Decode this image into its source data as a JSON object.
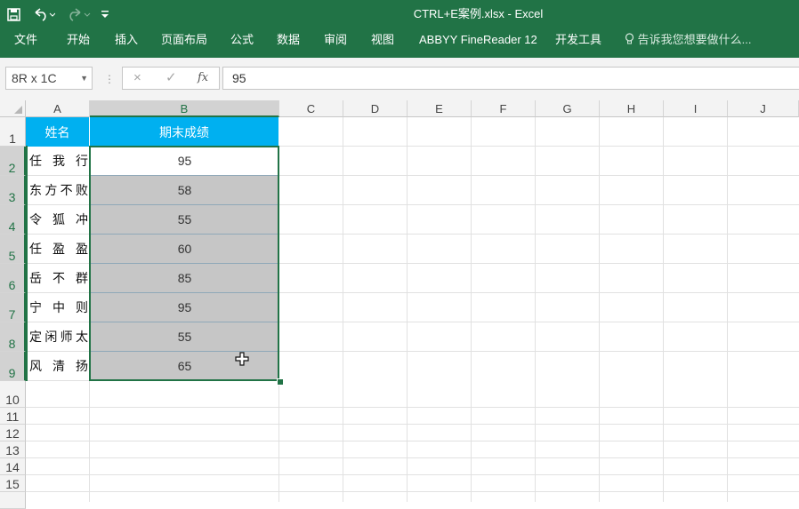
{
  "window": {
    "title": "CTRL+E案例.xlsx - Excel"
  },
  "quick_access": {
    "save_icon": "save-icon",
    "undo_icon": "undo-icon",
    "redo_icon": "redo-icon",
    "customize_icon": "customize-icon"
  },
  "ribbon": {
    "tabs": [
      "文件",
      "开始",
      "插入",
      "页面布局",
      "公式",
      "数据",
      "审阅",
      "视图",
      "ABBYY FineReader 12",
      "开发工具"
    ],
    "tell_me": "告诉我您想要做什么..."
  },
  "formula_bar": {
    "name_box": "8R x 1C",
    "cancel_icon": "×",
    "enter_icon": "✓",
    "fx_label": "fx",
    "value": "95"
  },
  "columns": [
    "A",
    "B",
    "C",
    "D",
    "E",
    "F",
    "G",
    "H",
    "I",
    "J"
  ],
  "rows": [
    "1",
    "2",
    "3",
    "4",
    "5",
    "6",
    "7",
    "8",
    "9",
    "10",
    "11",
    "12",
    "13",
    "14",
    "15"
  ],
  "table": {
    "headers": [
      "姓名",
      "期末成绩"
    ],
    "names": [
      [
        "任",
        "我",
        "行"
      ],
      [
        "东",
        "方",
        "不",
        "败"
      ],
      [
        "令",
        "狐",
        "冲"
      ],
      [
        "任",
        "盈",
        "盈"
      ],
      [
        "岳",
        "不",
        "群"
      ],
      [
        "宁",
        "中",
        "则"
      ],
      [
        "定",
        "闲",
        "师",
        "太"
      ],
      [
        "风",
        "清",
        "扬"
      ]
    ],
    "scores": [
      "95",
      "58",
      "55",
      "60",
      "85",
      "95",
      "55",
      "65"
    ]
  },
  "colors": {
    "excel_green": "#217346",
    "header_fill": "#00b0f0",
    "selection_fill": "#c6c6c6"
  }
}
